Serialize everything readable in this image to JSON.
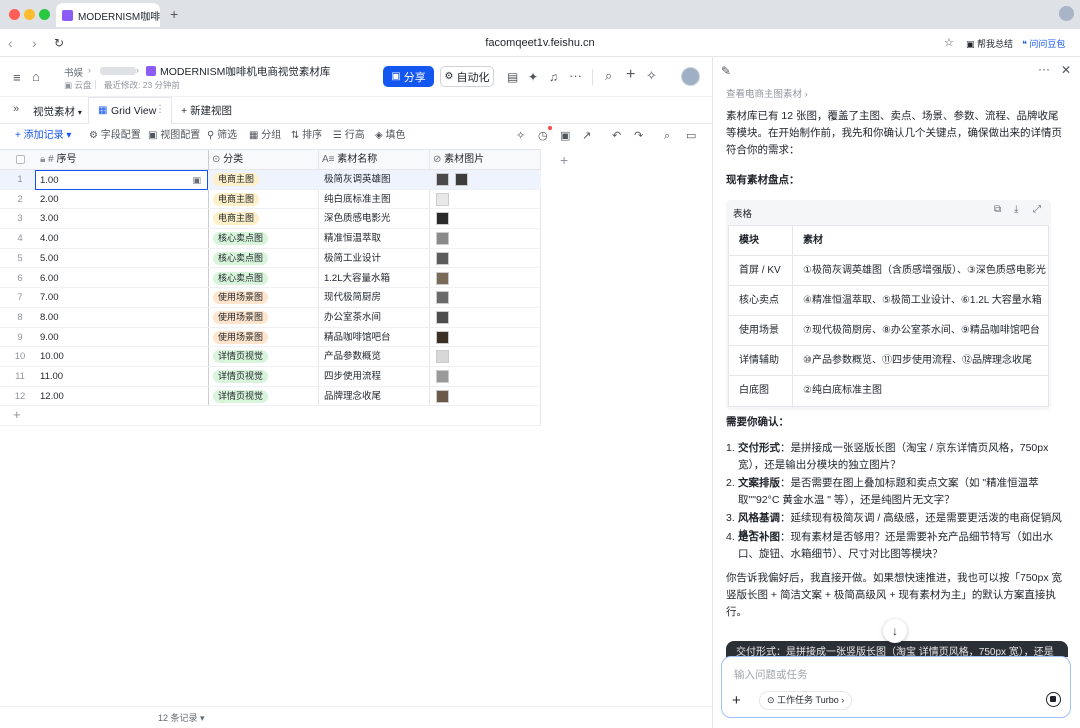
{
  "browser": {
    "tab_title": "MODERNISM咖啡机",
    "url": "facomqeet1v.feishu.cn",
    "actions": [
      "帮我总结",
      "问问豆包"
    ]
  },
  "header": {
    "breadcrumb_root": "书娱",
    "doc_title": "MODERNISM咖啡机电商视觉素材库",
    "location": "云盘",
    "last_modified": "最近修改: 23 分钟前",
    "share_label": "分享",
    "automation_label": "自动化"
  },
  "views": {
    "table_name": "视觉素材",
    "grid_view": "Grid View",
    "new_view": "新建视图"
  },
  "toolbar": {
    "add_record": "添加记录",
    "field_config": "字段配置",
    "view_config": "视图配置",
    "filter": "筛选",
    "group": "分组",
    "sort": "排序",
    "row_height": "行高",
    "fill_color": "填色"
  },
  "grid": {
    "columns": [
      "序号",
      "分类",
      "素材名称",
      "素材图片"
    ],
    "rows": [
      {
        "n": "1",
        "seq": "1.00",
        "cat": "电商主图",
        "name": "极简灰调英雄图"
      },
      {
        "n": "2",
        "seq": "2.00",
        "cat": "电商主图",
        "name": "纯白底标准主图"
      },
      {
        "n": "3",
        "seq": "3.00",
        "cat": "电商主图",
        "name": "深色质感电影光"
      },
      {
        "n": "4",
        "seq": "4.00",
        "cat": "核心卖点图",
        "name": "精准恒温萃取"
      },
      {
        "n": "5",
        "seq": "5.00",
        "cat": "核心卖点图",
        "name": "极简工业设计"
      },
      {
        "n": "6",
        "seq": "6.00",
        "cat": "核心卖点图",
        "name": "1.2L大容量水箱"
      },
      {
        "n": "7",
        "seq": "7.00",
        "cat": "使用场景图",
        "name": "现代极简厨房"
      },
      {
        "n": "8",
        "seq": "8.00",
        "cat": "使用场景图",
        "name": "办公室茶水间"
      },
      {
        "n": "9",
        "seq": "9.00",
        "cat": "使用场景图",
        "name": "精品咖啡馆吧台"
      },
      {
        "n": "10",
        "seq": "10.00",
        "cat": "详情页视觉",
        "name": "产品参数概览"
      },
      {
        "n": "11",
        "seq": "11.00",
        "cat": "详情页视觉",
        "name": "四步使用流程"
      },
      {
        "n": "12",
        "seq": "12.00",
        "cat": "详情页视觉",
        "name": "品牌理念收尾"
      }
    ],
    "record_count": "12 条记录"
  },
  "tag_colors": {
    "电商主图": "#fdf0c8",
    "核心卖点图": "#d8f5dc",
    "使用场景图": "#fde4cc",
    "详情页视觉": "#d8f5dc"
  },
  "panel": {
    "source_link": "查看电商主图素材",
    "intro": "素材库已有 12 张图，覆盖了主图、卖点、场景、参数、流程、品牌收尾等模块。在开始制作前，我先和你确认几个关键点，确保做出来的详情页符合你的需求：",
    "inventory_title": "现有素材盘点：",
    "table_label": "表格",
    "table_headers": [
      "模块",
      "素材"
    ],
    "table_rows": [
      {
        "module": "首屏 / KV",
        "assets": "①极简灰调英雄图（含质感增强版）、③深色质感电影光"
      },
      {
        "module": "核心卖点",
        "assets": "④精准恒温萃取、⑤极简工业设计、⑥1.2L 大容量水箱"
      },
      {
        "module": "使用场景",
        "assets": "⑦现代极简厨房、⑧办公室茶水间、⑨精品咖啡馆吧台"
      },
      {
        "module": "详情辅助",
        "assets": "⑩产品参数概览、⑪四步使用流程、⑫品牌理念收尾"
      },
      {
        "module": "白底图",
        "assets": "②纯白底标准主图"
      }
    ],
    "confirm_title": "需要你确认：",
    "questions": [
      {
        "num": "1.",
        "label": "交付形式",
        "text": "：是拼接成一张竖版长图（淘宝 / 京东详情页风格，750px 宽），还是输出分模块的独立图片？"
      },
      {
        "num": "2.",
        "label": "文案排版",
        "text": "：是否需要在图上叠加标题和卖点文案（如 \"精准恒温萃取\"\"92°C 黄金水温 \" 等），还是纯图片无文字？"
      },
      {
        "num": "3.",
        "label": "风格基调",
        "text": "：延续现有极简灰调 / 高级感，还是需要更活泼的电商促销风格？"
      },
      {
        "num": "4.",
        "label": "是否补图",
        "text": "：现有素材是否够用？还是需要补充产品细节特写（如出水口、旋钮、水箱细节）、尺寸对比图等模块？"
      }
    ],
    "closing": "你告诉我偏好后，我直接开做。如果想快速推进，我也可以按「750px 宽竖版长图 + 简洁文案 + 极简高级风 + 现有素材为主」的默认方案直接执行。",
    "preview": "交付形式：是拼接成一张竖版长图（淘宝 详情页风格，750px 宽），还是",
    "input_placeholder": "输入问题或任务",
    "mode_label": "工作任务 Turbo"
  }
}
